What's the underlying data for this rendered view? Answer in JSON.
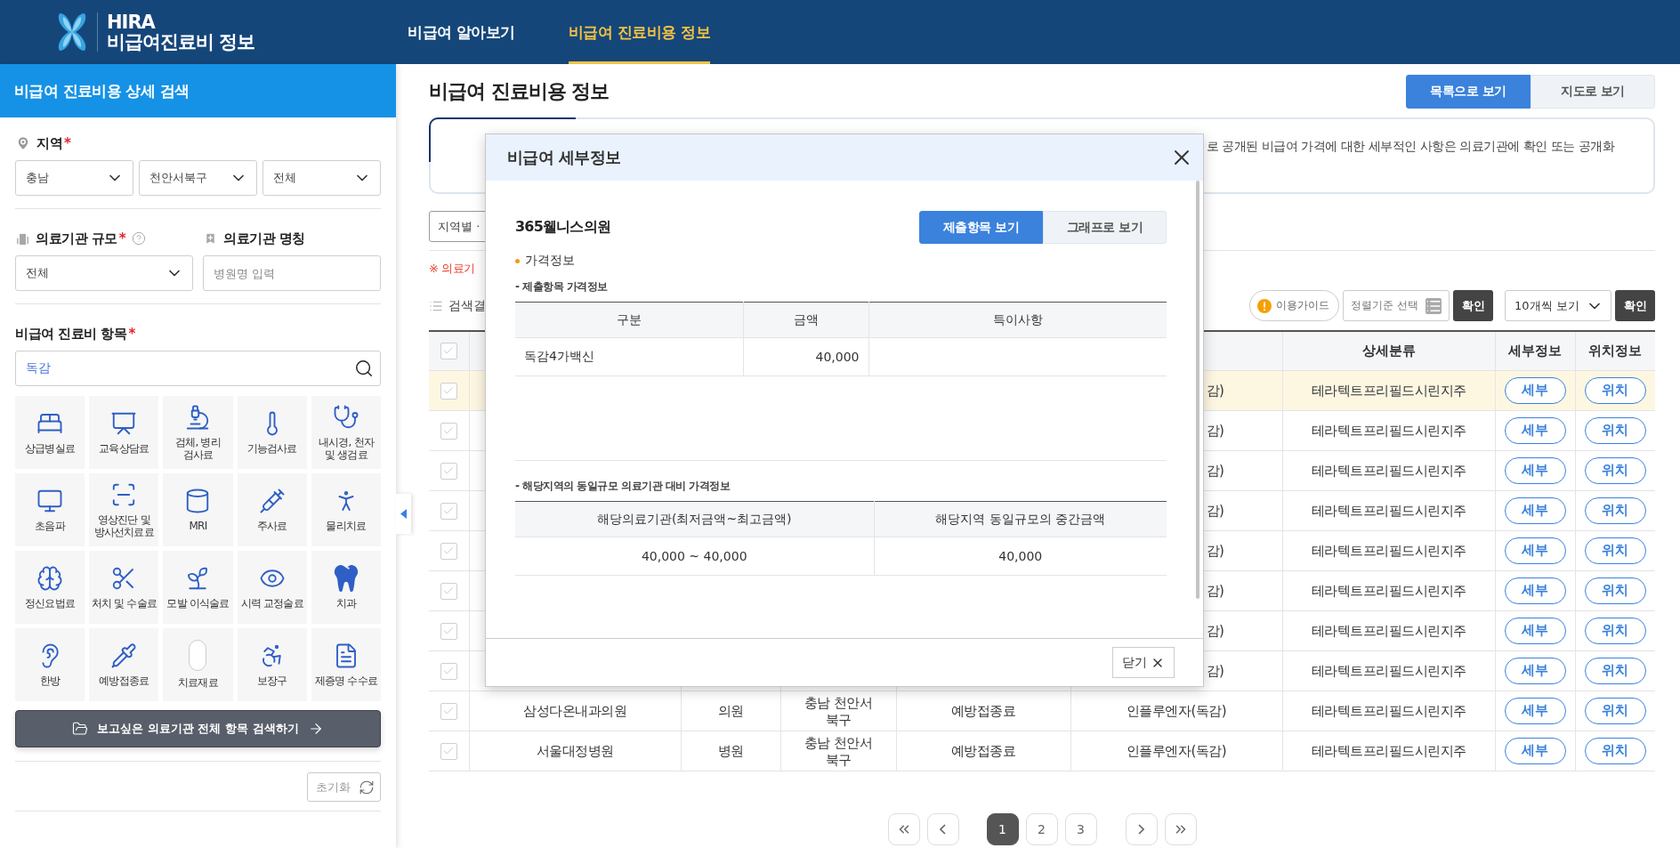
{
  "header": {
    "logo": {
      "line1": "HIRA",
      "line2": "비급여진료비 정보"
    },
    "nav": [
      {
        "label": "비급여 알아보기",
        "selected": false
      },
      {
        "label": "비급여 진료비용 정보",
        "selected": true
      }
    ]
  },
  "sidebar": {
    "title": "비급여 진료비용 상세 검색",
    "region": {
      "label": "지역",
      "required": "*",
      "selects": [
        "충남",
        "천안서북구",
        "전체"
      ]
    },
    "scale": {
      "label": "의료기관 규모",
      "required": "*",
      "value": "전체"
    },
    "institution": {
      "label": "의료기관 명칭",
      "placeholder": "병원명 입력"
    },
    "items": {
      "label": "비급여 진료비 항목",
      "required": "*",
      "search_value": "독감",
      "categories": [
        "상급병실료",
        "교육상담료",
        "검체, 병리\n검사료",
        "기능검사료",
        "내시경, 천자\n및 생검료",
        "초음파",
        "영상진단 및\n방사선치료료",
        "MRI",
        "주사료",
        "물리치료",
        "정신요법료",
        "처치 및 수술료",
        "모발 이식술료",
        "시력 교정술료",
        "치과",
        "한방",
        "예방접종료",
        "치료재료",
        "보장구",
        "제증명 수수료"
      ]
    },
    "search_all_button": "보고싶은 의료기관 전체 항목 검색하기",
    "reset_button": "초기화"
  },
  "main": {
    "title": "비급여 진료비용 정보",
    "view_toggle": [
      {
        "label": "목록으로 보기",
        "selected": true
      },
      {
        "label": "지도로 보기",
        "selected": false
      }
    ],
    "notice": "로 공개된 비급여 가격에 대한 세부적인 사항은 의료기관에 확인 또는 공개화",
    "filter_chip": "지역별 ·",
    "note": "※ 의료기",
    "results_label": "검색결",
    "tools": {
      "guide": "이용가이드",
      "sort": "정렬기준 선택",
      "confirm_sort": "확인",
      "page_size": "10개씩 보기",
      "confirm_size": "확인"
    },
    "table": {
      "header_checked": false,
      "columns": [
        "상세분류",
        "세부정보",
        "위치정보"
      ],
      "rows": [
        {
          "kind": "covered",
          "selected": true,
          "checked": false,
          "item": "감)",
          "detail": "테라텍트프리필드시린지주",
          "info_button": "세부",
          "location_button": "위치"
        },
        {
          "kind": "covered",
          "selected": false,
          "checked": false,
          "item": "감)",
          "detail": "테라텍트프리필드시린지주",
          "info_button": "세부",
          "location_button": "위치"
        },
        {
          "kind": "covered",
          "selected": false,
          "checked": false,
          "item": "감)",
          "detail": "테라텍트프리필드시린지주",
          "info_button": "세부",
          "location_button": "위치"
        },
        {
          "kind": "covered",
          "selected": false,
          "checked": false,
          "item": "감)",
          "detail": "테라텍트프리필드시린지주",
          "info_button": "세부",
          "location_button": "위치"
        },
        {
          "kind": "covered",
          "selected": false,
          "checked": false,
          "item": "감)",
          "detail": "테라텍트프리필드시린지주",
          "info_button": "세부",
          "location_button": "위치"
        },
        {
          "kind": "covered",
          "selected": false,
          "checked": false,
          "item": "감)",
          "detail": "테라텍트프리필드시린지주",
          "info_button": "세부",
          "location_button": "위치"
        },
        {
          "kind": "covered",
          "selected": false,
          "checked": false,
          "item": "감)",
          "detail": "테라텍트프리필드시린지주",
          "info_button": "세부",
          "location_button": "위치"
        },
        {
          "kind": "covered",
          "selected": false,
          "checked": false,
          "item": "감)",
          "detail": "테라텍트프리필드시린지주",
          "info_button": "세부",
          "location_button": "위치"
        },
        {
          "kind": "full",
          "selected": false,
          "checked": false,
          "name": "삼성다온내과의원",
          "type": "의원",
          "region": "충남 천안서\n북구",
          "category": "예방접종료",
          "item": "인플루엔자(독감)",
          "detail": "테라텍트프리필드시린지주",
          "info_button": "세부",
          "location_button": "위치"
        },
        {
          "kind": "full",
          "selected": false,
          "checked": false,
          "name": "서울대정병원",
          "type": "병원",
          "region": "충남 천안서\n북구",
          "category": "예방접종료",
          "item": "인플루엔자(독감)",
          "detail": "테라텍트프리필드시린지주",
          "info_button": "세부",
          "location_button": "위치"
        }
      ]
    },
    "pagination": [
      {
        "label": "1",
        "selected": true
      },
      {
        "label": "2",
        "selected": false
      },
      {
        "label": "3",
        "selected": false
      }
    ]
  },
  "modal": {
    "title": "비급여 세부정보",
    "hospital": "365웰니스의원",
    "view_toggle": [
      {
        "label": "제출항목 보기",
        "selected": true
      },
      {
        "label": "그래프로 보기",
        "selected": false
      }
    ],
    "section": "가격정보",
    "sub1": "- 제출항목 가격정보",
    "table1": {
      "columns": [
        "구분",
        "금액",
        "특이사항"
      ],
      "rows": [
        {
          "item": "독감4가백신",
          "amount": "40,000"
        }
      ]
    },
    "sub2": "- 해당지역의 동일규모 의료기관 대비 가격정보",
    "table2": {
      "columns": [
        "해당의료기관(최저금액~최고금액)",
        "해당지역 동일규모의 중간금액"
      ],
      "rows": [
        {
          "range": "40,000 ~ 40,000",
          "median": "40,000"
        }
      ]
    },
    "close_button": "닫기"
  }
}
